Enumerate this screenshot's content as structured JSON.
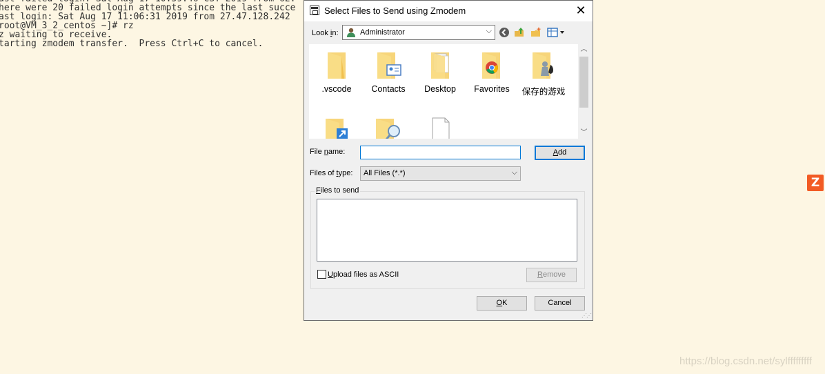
{
  "terminal": {
    "lines": [
      "here were 20 failed login attempts since the last succe",
      "ast login: Sat Aug 17 11:06:31 2019 from 27.47.128.242",
      "root@VM_3_2_centos ~]# rz",
      "z waiting to receive.",
      "tarting zmodem transfer.  Press Ctrl+C to cancel."
    ]
  },
  "dialog": {
    "title": "Select Files to Send using Zmodem",
    "look_in_label": "Look in:",
    "look_in_value": "Administrator",
    "files": [
      {
        "name": ".vscode",
        "icon": "folder-icon"
      },
      {
        "name": "Contacts",
        "icon": "contacts-folder-icon"
      },
      {
        "name": "Desktop",
        "icon": "desktop-folder-icon"
      },
      {
        "name": "Favorites",
        "icon": "favorites-folder-icon"
      },
      {
        "name": "保存的游戏",
        "icon": "saved-games-folder-icon"
      },
      {
        "name": "",
        "icon": "links-folder-icon"
      },
      {
        "name": "",
        "icon": "searches-folder-icon"
      },
      {
        "name": "",
        "icon": "file-icon"
      }
    ],
    "file_name_label": "File name:",
    "file_name_value": "",
    "add_label": "Add",
    "files_of_type_label": "Files of type:",
    "files_of_type_value": "All Files (*.*)",
    "files_to_send_label": "Files to send",
    "upload_ascii_label": "Upload files as ASCII",
    "upload_ascii_checked": false,
    "remove_label": "Remove",
    "ok_label": "OK",
    "cancel_label": "Cancel"
  },
  "watermark": "https://blog.csdn.net/sylfffffffff",
  "colors": {
    "terminal_bg": "#fdf6e3",
    "dialog_bg": "#f0f0f0",
    "focus_blue": "#0078d7",
    "widget_orange": "#f25b24"
  }
}
